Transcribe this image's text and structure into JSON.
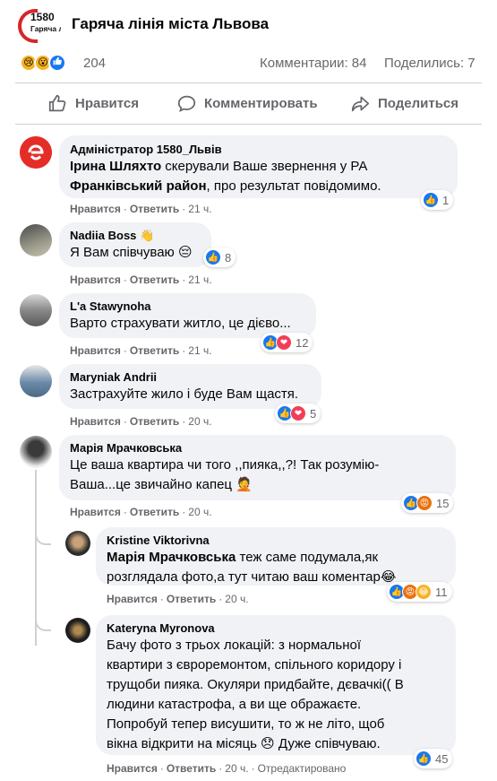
{
  "header": {
    "logo_number": "1580",
    "logo_sub": "Гаряча лінія міста Львова",
    "title": "Гаряча лінія міста Львова"
  },
  "stats": {
    "reactions_count": "204",
    "comments": "Комментарии: 84",
    "shares": "Поделились: 7"
  },
  "actions": {
    "like": "Нравится",
    "comment": "Комментировать",
    "share": "Поделиться"
  },
  "labels": {
    "like": "Нравится",
    "reply": "Ответить",
    "dot": "·",
    "edited": "Отредактировано"
  },
  "comments": [
    {
      "author": "Адміністратор 1580_Львів",
      "mention1": "Ірина Шляхто",
      "text1": " скерували Ваше звернення у РА ",
      "mention2": "Франківський район",
      "text2": ", про результат повідомимо.",
      "time": "21 ч.",
      "reactions": "1"
    },
    {
      "author": "Nadiia Boss 👋",
      "text": "Я Вам співчуваю 😔",
      "time": "21 ч.",
      "reactions": "8"
    },
    {
      "author": "L'a Stawynoha",
      "text": "Варто страхувати житло, це дієво...",
      "time": "21 ч.",
      "reactions": "12"
    },
    {
      "author": "Maryniak Andrii",
      "text": "Застрахуйте жило і буде Вам щастя.",
      "time": "20 ч.",
      "reactions": "5"
    },
    {
      "author": "Марія Мрачковська",
      "text1": "Це ваша квартира чи того ,,пияка,,?! Так розумію-",
      "text2": "Ваша...це звичайно капец 🤦",
      "time": "20 ч.",
      "reactions": "15"
    }
  ],
  "replies": [
    {
      "author": "Kristine Viktorivna",
      "mention": "Марія Мрачковська",
      "text1": " теж саме подумала,як",
      "text2": "розглядала фото,а тут читаю ваш коментар😂",
      "time": "20 ч.",
      "reactions": "11"
    },
    {
      "author": "Kateryna Myronova",
      "lines": [
        "Бачу фото з трьох локацій: з нормальної",
        "квартири з євроремонтом, спільного коридору і",
        "трущоби пияка. Окуляри придбайте, дєвачкі(( В",
        "людини катастрофа, а ви ще ображаєте.",
        "Попробуй тепер висушити, то ж не літо, щоб",
        "вікна відкрити на місяць 😞 Дуже співчуваю."
      ],
      "time": "20 ч.",
      "reactions": "45"
    }
  ],
  "colors": {
    "like_blue": "#1877f2",
    "love_red": "#f33e58",
    "angry_orange": "#e9710f",
    "haha_yellow": "#f7b125",
    "bubble_bg": "#f0f2f5",
    "meta_gray": "#65676b",
    "brand_red": "#d9252a"
  },
  "icons": {
    "like": "thumbs-up-icon",
    "comment": "speech-bubble-icon",
    "share": "share-arrow-icon"
  }
}
